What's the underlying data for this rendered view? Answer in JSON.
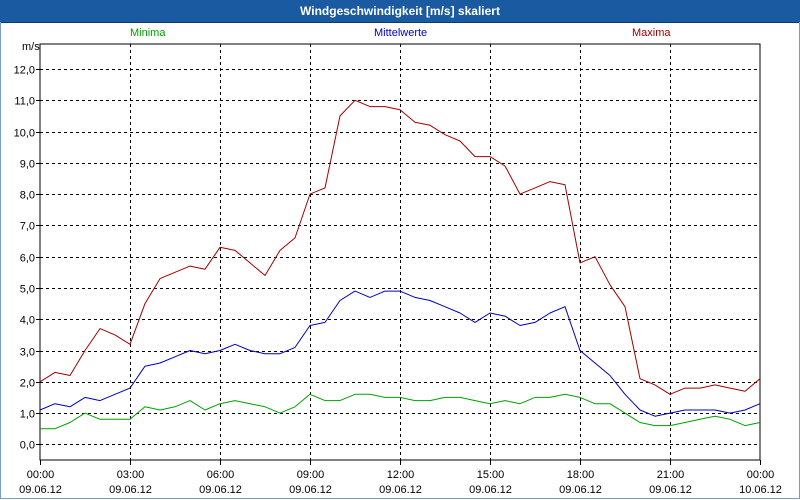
{
  "window": {
    "title": "Windgeschwindigkeit [m/s] skaliert"
  },
  "chart_data": {
    "type": "line",
    "title": "Windgeschwindigkeit [m/s] skaliert",
    "ylabel": "m/s",
    "xlabel": "",
    "ylim": [
      -0.5,
      12.8
    ],
    "xlim": [
      0,
      24
    ],
    "grid": true,
    "legend": [
      "Minima",
      "Mittelwerte",
      "Maxima"
    ],
    "colors": {
      "Minima": "#00a000",
      "Mittelwerte": "#0000c0",
      "Maxima": "#a00000"
    },
    "yticks": [
      "0,0",
      "1,0",
      "2,0",
      "3,0",
      "4,0",
      "5,0",
      "6,0",
      "7,0",
      "8,0",
      "9,0",
      "10,0",
      "11,0",
      "12,0"
    ],
    "xticks": [
      {
        "time": "00:00",
        "date": "09.06.12"
      },
      {
        "time": "03:00",
        "date": "09.06.12"
      },
      {
        "time": "06:00",
        "date": "09.06.12"
      },
      {
        "time": "09:00",
        "date": "09.06.12"
      },
      {
        "time": "12:00",
        "date": "09.06.12"
      },
      {
        "time": "15:00",
        "date": "09.06.12"
      },
      {
        "time": "18:00",
        "date": "09.06.12"
      },
      {
        "time": "21:00",
        "date": "09.06.12"
      },
      {
        "time": "00:00",
        "date": "10.06.12"
      }
    ],
    "x": [
      0,
      0.5,
      1,
      1.5,
      2,
      2.5,
      3,
      3.5,
      4,
      4.5,
      5,
      5.5,
      6,
      6.5,
      7,
      7.5,
      8,
      8.5,
      9,
      9.5,
      10,
      10.5,
      11,
      11.5,
      12,
      12.5,
      13,
      13.5,
      14,
      14.5,
      15,
      15.5,
      16,
      16.5,
      17,
      17.5,
      18,
      18.5,
      19,
      19.5,
      20,
      20.5,
      21,
      21.5,
      22,
      22.5,
      23,
      23.5,
      24
    ],
    "series": [
      {
        "name": "Minima",
        "values": [
          0.5,
          0.5,
          0.7,
          1.0,
          0.8,
          0.8,
          0.8,
          1.2,
          1.1,
          1.2,
          1.4,
          1.1,
          1.3,
          1.4,
          1.3,
          1.2,
          1.0,
          1.2,
          1.6,
          1.4,
          1.4,
          1.6,
          1.6,
          1.5,
          1.5,
          1.4,
          1.4,
          1.5,
          1.5,
          1.4,
          1.3,
          1.4,
          1.3,
          1.5,
          1.5,
          1.6,
          1.5,
          1.3,
          1.3,
          1.0,
          0.7,
          0.6,
          0.6,
          0.7,
          0.8,
          0.9,
          0.8,
          0.6,
          0.7
        ]
      },
      {
        "name": "Mittelwerte",
        "values": [
          1.1,
          1.3,
          1.2,
          1.5,
          1.4,
          1.6,
          1.8,
          2.5,
          2.6,
          2.8,
          3.0,
          2.9,
          3.0,
          3.2,
          3.0,
          2.9,
          2.9,
          3.1,
          3.8,
          3.9,
          4.6,
          4.9,
          4.7,
          4.9,
          4.9,
          4.7,
          4.6,
          4.4,
          4.2,
          3.9,
          4.2,
          4.1,
          3.8,
          3.9,
          4.2,
          4.4,
          3.0,
          2.6,
          2.2,
          1.6,
          1.1,
          0.9,
          1.0,
          1.1,
          1.1,
          1.1,
          1.0,
          1.1,
          1.3
        ]
      },
      {
        "name": "Maxima",
        "values": [
          2.0,
          2.3,
          2.2,
          3.0,
          3.7,
          3.5,
          3.2,
          4.5,
          5.3,
          5.5,
          5.7,
          5.6,
          6.3,
          6.2,
          5.8,
          5.4,
          6.2,
          6.6,
          8.0,
          8.2,
          10.5,
          11.0,
          10.8,
          10.8,
          10.7,
          10.3,
          10.2,
          9.9,
          9.7,
          9.2,
          9.2,
          8.9,
          8.0,
          8.2,
          8.4,
          8.3,
          5.8,
          6.0,
          5.1,
          4.4,
          2.1,
          1.9,
          1.6,
          1.8,
          1.8,
          1.9,
          1.8,
          1.7,
          2.1
        ]
      }
    ]
  }
}
